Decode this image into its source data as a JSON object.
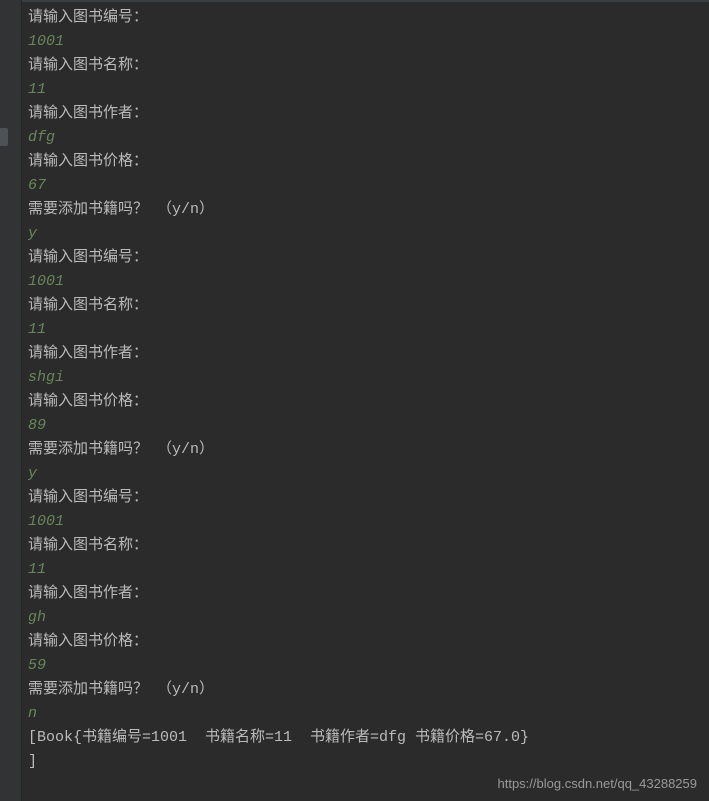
{
  "lines": [
    {
      "type": "prompt",
      "text": "请输入图书编号："
    },
    {
      "type": "input",
      "text": "1001"
    },
    {
      "type": "prompt",
      "text": "请输入图书名称："
    },
    {
      "type": "input",
      "text": "11"
    },
    {
      "type": "prompt",
      "text": "请输入图书作者："
    },
    {
      "type": "input",
      "text": "dfg"
    },
    {
      "type": "prompt",
      "text": "请输入图书价格："
    },
    {
      "type": "input",
      "text": "67"
    },
    {
      "type": "prompt",
      "text": "需要添加书籍吗？ （y/n）"
    },
    {
      "type": "input",
      "text": "y"
    },
    {
      "type": "prompt",
      "text": "请输入图书编号："
    },
    {
      "type": "input",
      "text": "1001"
    },
    {
      "type": "prompt",
      "text": "请输入图书名称："
    },
    {
      "type": "input",
      "text": "11"
    },
    {
      "type": "prompt",
      "text": "请输入图书作者："
    },
    {
      "type": "input",
      "text": "shgi"
    },
    {
      "type": "prompt",
      "text": "请输入图书价格："
    },
    {
      "type": "input",
      "text": "89"
    },
    {
      "type": "prompt",
      "text": "需要添加书籍吗？ （y/n）"
    },
    {
      "type": "input",
      "text": "y"
    },
    {
      "type": "prompt",
      "text": "请输入图书编号："
    },
    {
      "type": "input",
      "text": "1001"
    },
    {
      "type": "prompt",
      "text": "请输入图书名称："
    },
    {
      "type": "input",
      "text": "11"
    },
    {
      "type": "prompt",
      "text": "请输入图书作者："
    },
    {
      "type": "input",
      "text": "gh"
    },
    {
      "type": "prompt",
      "text": "请输入图书价格："
    },
    {
      "type": "input",
      "text": "59"
    },
    {
      "type": "prompt",
      "text": "需要添加书籍吗？ （y/n）"
    },
    {
      "type": "input",
      "text": "n"
    },
    {
      "type": "output",
      "text": "[Book{书籍编号=1001  书籍名称=11  书籍作者=dfg 书籍价格=67.0}"
    },
    {
      "type": "output",
      "text": "]"
    }
  ],
  "watermark": "https://blog.csdn.net/qq_43288259"
}
